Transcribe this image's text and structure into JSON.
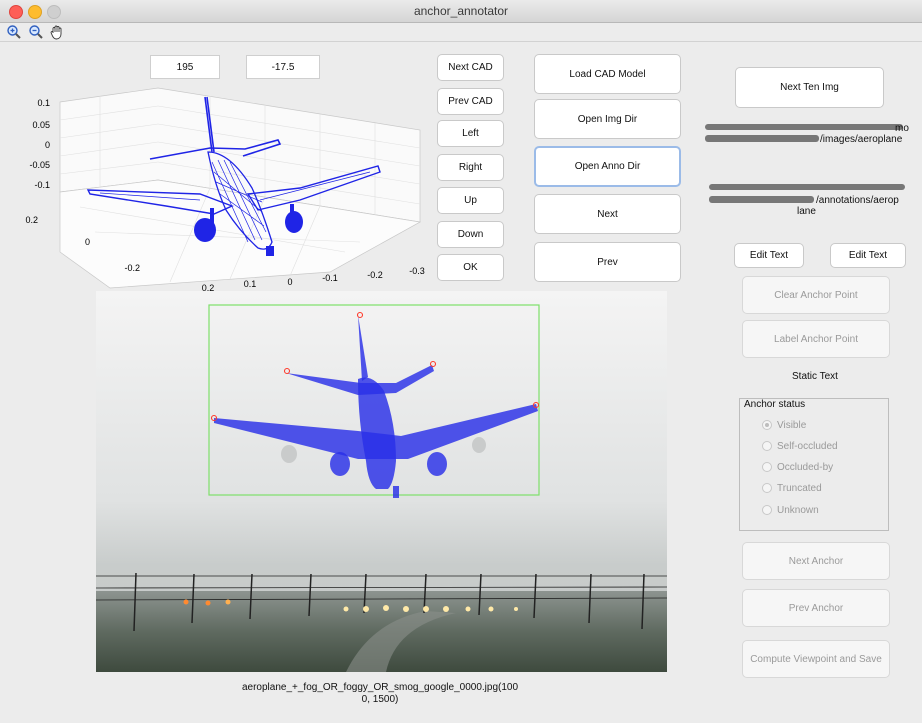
{
  "window": {
    "title": "anchor_annotator"
  },
  "toolbar": {
    "zoom_in": "zoom-in-icon",
    "zoom_out": "zoom-out-icon",
    "pan": "pan-hand-icon"
  },
  "view_fields": {
    "azimuth": "195",
    "elevation": "-17.5"
  },
  "cad_buttons": {
    "next_cad": "Next CAD",
    "prev_cad": "Prev CAD",
    "left": "Left",
    "right": "Right",
    "up": "Up",
    "down": "Down",
    "ok": "OK"
  },
  "main_buttons": {
    "load_cad": "Load CAD Model",
    "open_img_dir": "Open Img Dir",
    "open_anno_dir": "Open Anno Dir",
    "next": "Next",
    "prev": "Prev"
  },
  "right_panel": {
    "next_ten_img": "Next Ten Img",
    "img_dir_tail1": "mo",
    "img_dir_tail2": "/images/aeroplane",
    "anno_dir_tail1": "/annotations/aerop",
    "anno_dir_tail2": "lane",
    "edit_text_1": "Edit Text",
    "edit_text_2": "Edit Text",
    "clear_anchor": "Clear Anchor Point",
    "label_anchor": "Label Anchor Point",
    "static_text": "Static Text",
    "anchor_status_title": "Anchor status",
    "anchor_status_options": [
      "Visible",
      "Self-occluded",
      "Occluded-by",
      "Truncated",
      "Unknown"
    ],
    "anchor_status_selected": "Visible",
    "next_anchor": "Next Anchor",
    "prev_anchor": "Prev Anchor",
    "compute_viewpoint": "Compute Viewpoint and Save"
  },
  "plot3d": {
    "z_ticks": [
      "0.1",
      "0.05",
      "0",
      "-0.05",
      "-0.1"
    ],
    "y_ticks": [
      "0.2",
      "0",
      "-0.2"
    ],
    "x_ticks": [
      "0.2",
      "0.1",
      "0",
      "-0.1",
      "-0.2",
      "-0.3"
    ]
  },
  "image": {
    "caption_line1": "aeroplane_+_fog_OR_foggy_OR_smog_google_0000.jpg(100",
    "caption_line2": "0, 1500)"
  },
  "colors": {
    "model": "#1f24e6",
    "bbox": "#7ee06a",
    "anchor": "#ff3a2a"
  }
}
